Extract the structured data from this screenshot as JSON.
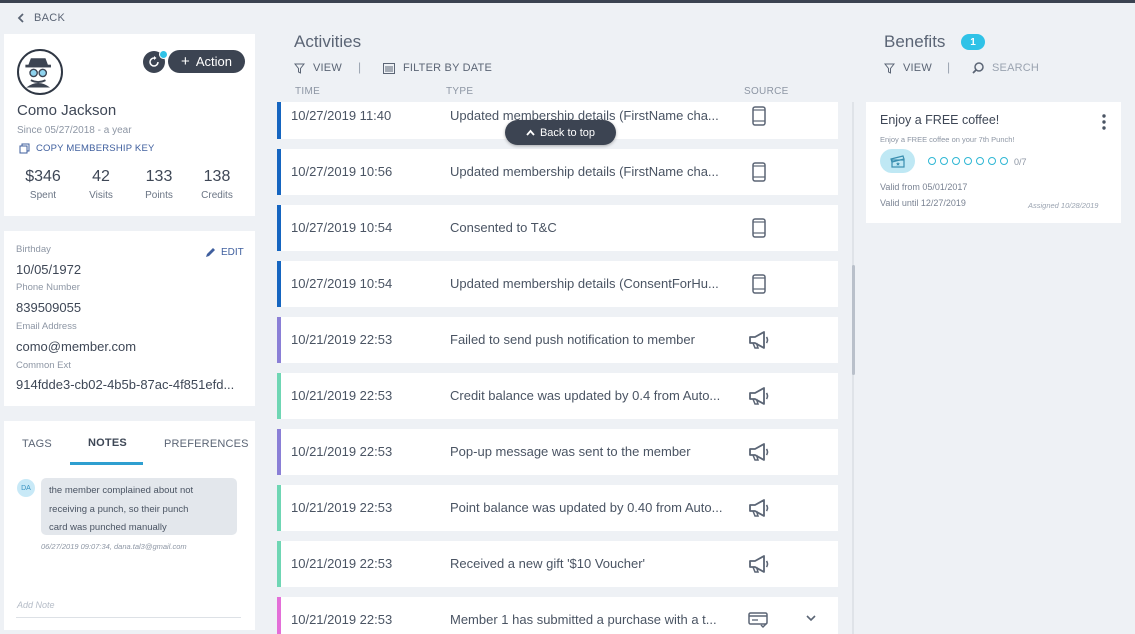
{
  "nav": {
    "back_label": "BACK"
  },
  "profile": {
    "name": "Como Jackson",
    "since": "Since 05/27/2018 - a year",
    "copy_label": "COPY MEMBERSHIP KEY",
    "action_label": "Action",
    "stats": [
      {
        "value": "$346",
        "label": "Spent"
      },
      {
        "value": "42",
        "label": "Visits"
      },
      {
        "value": "133",
        "label": "Points"
      },
      {
        "value": "138",
        "label": "Credits"
      }
    ]
  },
  "details": {
    "edit_label": "EDIT",
    "birthday_label": "Birthday",
    "birthday": "10/05/1972",
    "phone_label": "Phone Number",
    "phone": "839509055",
    "email_label": "Email Address",
    "email": "como@member.com",
    "common_ext_label": "Common Ext",
    "common_ext": "914fdde3-cb02-4b5b-87ac-4f851efd..."
  },
  "notes": {
    "tabs": [
      "TAGS",
      "NOTES",
      "PREFERENCES"
    ],
    "active_tab": "NOTES",
    "note": {
      "initials": "DA",
      "lines": [
        "the member complained about not",
        "receiving a punch, so their punch",
        "card was punched manually"
      ],
      "meta": "06/27/2019 09:07:34, dana.tal3@gmail.com"
    },
    "add_placeholder": "Add Note"
  },
  "activities": {
    "title": "Activities",
    "view_label": "VIEW",
    "filter_label": "FILTER BY DATE",
    "columns": {
      "time": "TIME",
      "type": "TYPE",
      "source": "SOURCE"
    },
    "back_to_top": "Back to top",
    "rows": [
      {
        "time": "10/27/2019 11:40",
        "type": "Updated membership details (FirstName cha...",
        "source": "phone-icon",
        "color": "#1565c0"
      },
      {
        "time": "10/27/2019 10:56",
        "type": "Updated membership details (FirstName cha...",
        "source": "phone-icon",
        "color": "#1565c0"
      },
      {
        "time": "10/27/2019 10:54",
        "type": "Consented to T&C",
        "source": "phone-icon",
        "color": "#1565c0"
      },
      {
        "time": "10/27/2019 10:54",
        "type": "Updated membership details (ConsentForHu...",
        "source": "phone-icon",
        "color": "#1565c0"
      },
      {
        "time": "10/21/2019 22:53",
        "type": "Failed to send push notification to member",
        "source": "megaphone-icon",
        "color": "#8a7fd6"
      },
      {
        "time": "10/21/2019 22:53",
        "type": "Credit balance was updated by 0.4 from Auto...",
        "source": "megaphone-icon",
        "color": "#6fd6b4"
      },
      {
        "time": "10/21/2019 22:53",
        "type": "Pop-up message was sent to the member",
        "source": "megaphone-icon",
        "color": "#8a7fd6"
      },
      {
        "time": "10/21/2019 22:53",
        "type": "Point balance was updated by 0.40 from Auto...",
        "source": "megaphone-icon",
        "color": "#6fd6b4"
      },
      {
        "time": "10/21/2019 22:53",
        "type": "Received a new gift '$10 Voucher'",
        "source": "megaphone-icon",
        "color": "#6fd6b4"
      },
      {
        "time": "10/21/2019 22:53",
        "type": "Member 1 has submitted a purchase with a t...",
        "source": "receipt-icon",
        "color": "#e36fd8"
      }
    ]
  },
  "benefits": {
    "title": "Benefits",
    "count": "1",
    "view_label": "VIEW",
    "search_label": "SEARCH",
    "item": {
      "title": "Enjoy a FREE coffee!",
      "subtitle": "Enjoy a FREE coffee on your 7th Punch!",
      "punches_done": 0,
      "punches_total": 7,
      "punch_count": "0/7",
      "valid_from": "Valid from 05/01/2017",
      "valid_until": "Valid until 12/27/2019",
      "assigned": "Assigned 10/28/2019"
    }
  }
}
